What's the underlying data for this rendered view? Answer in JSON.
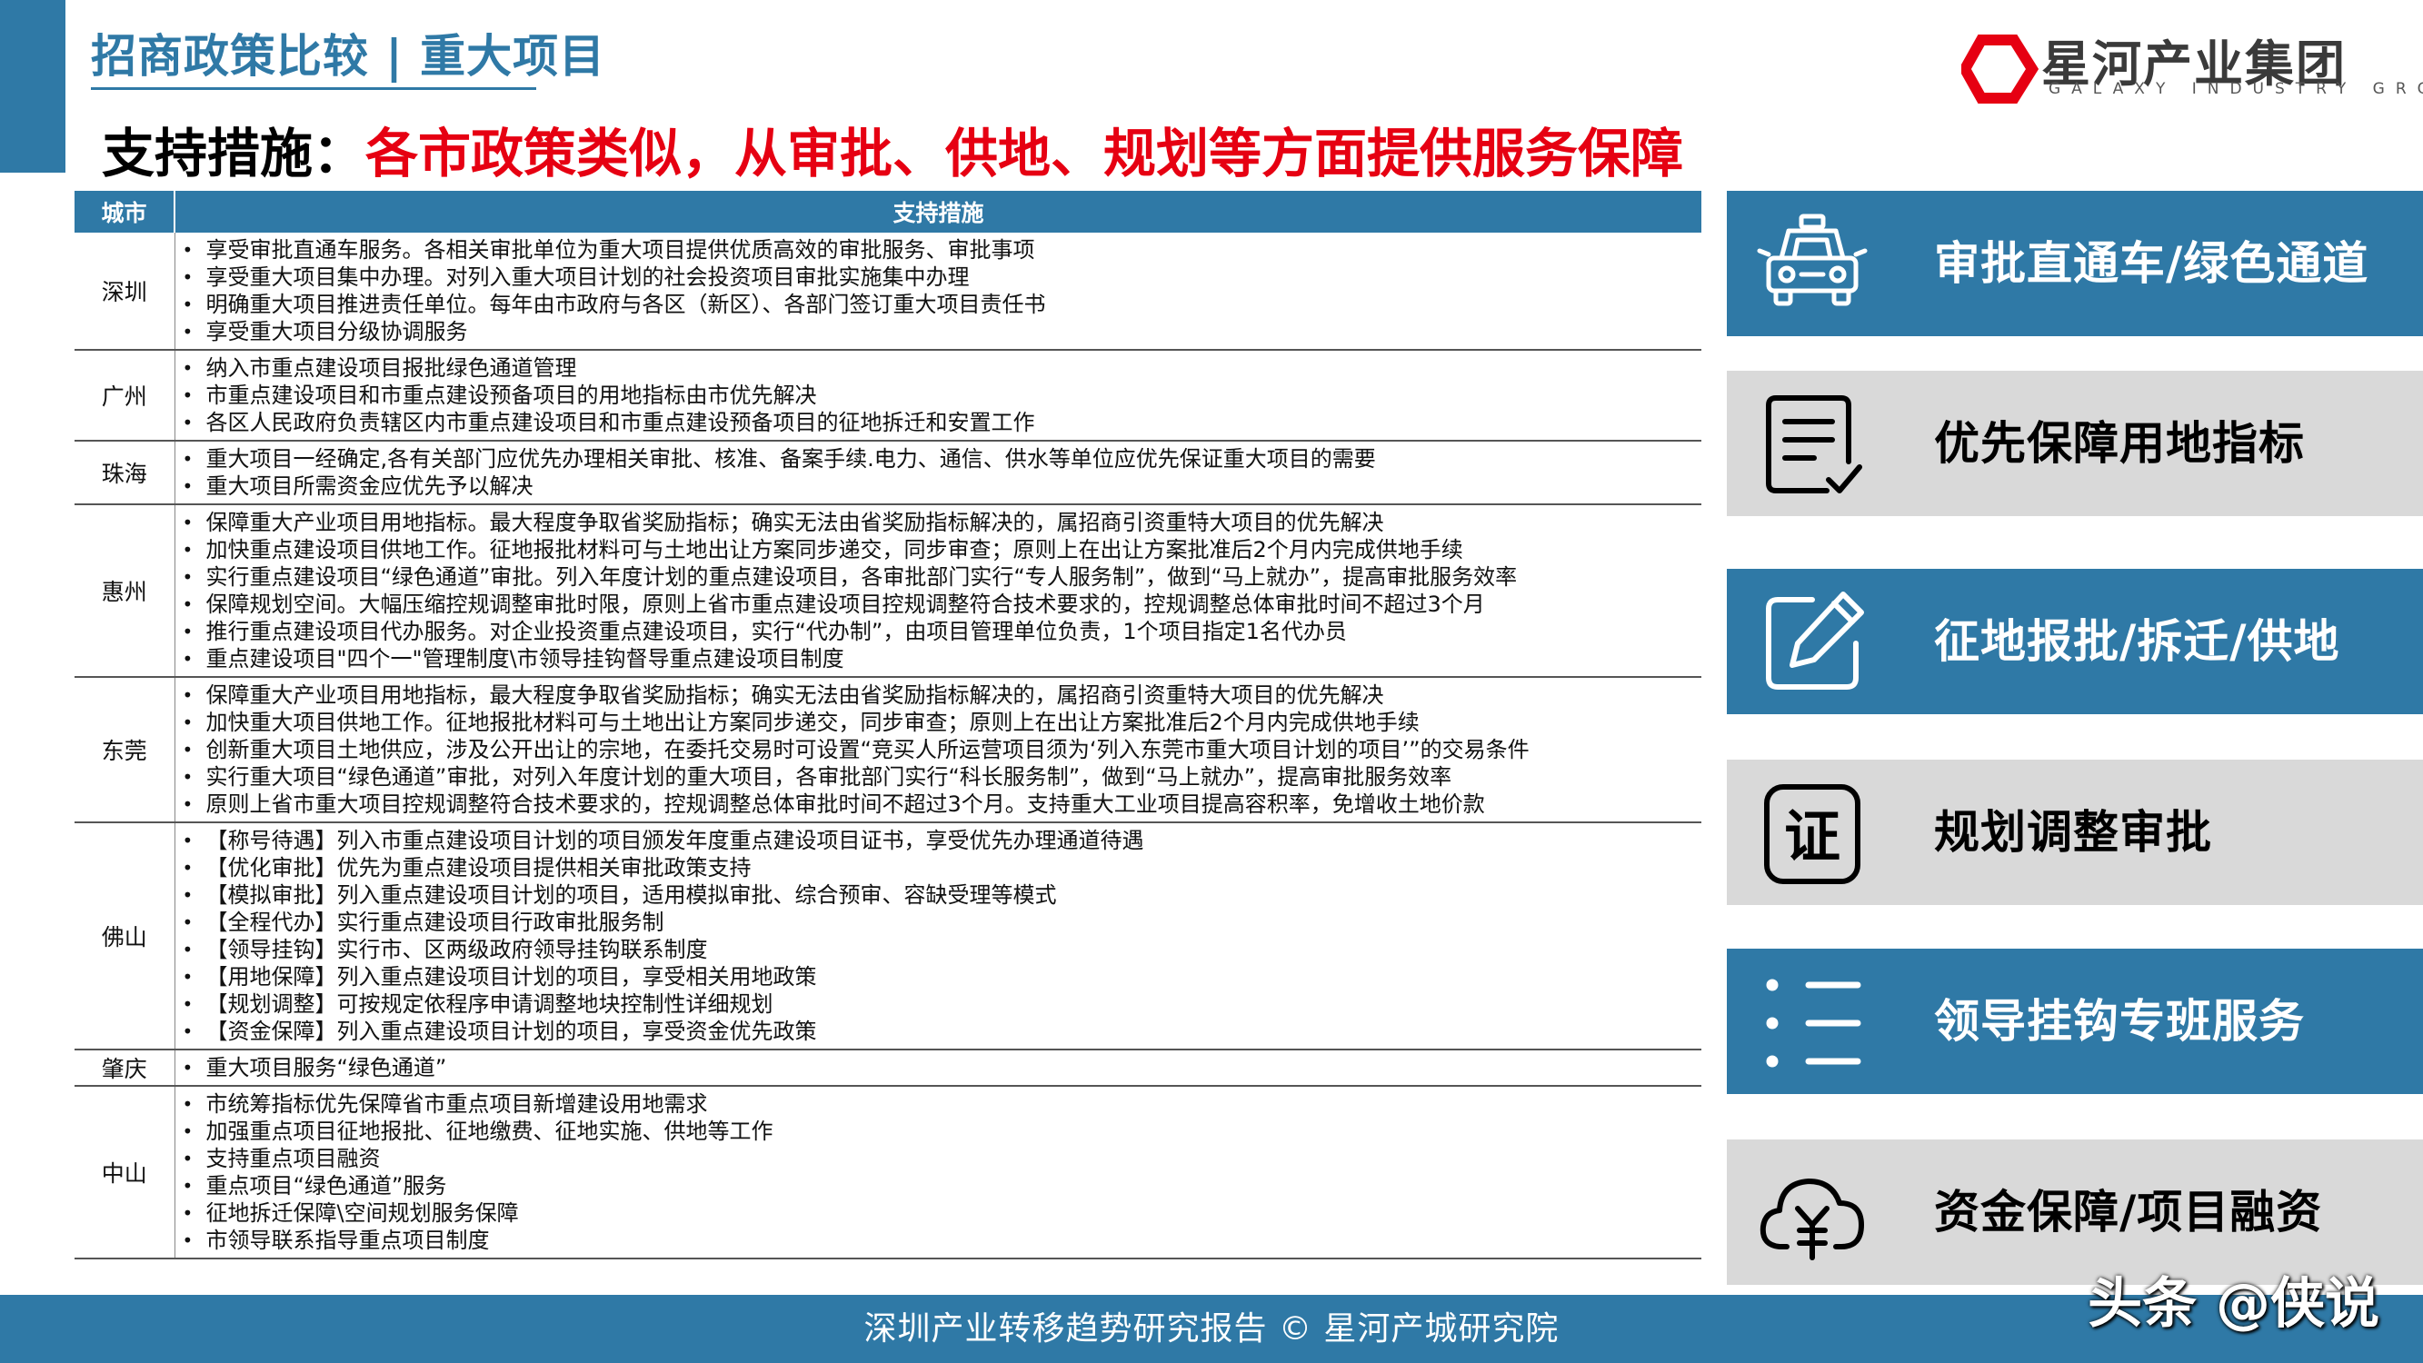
{
  "header": {
    "section_title": "招商政策比较 | 重大项目",
    "headline_prefix": "支持措施：",
    "headline_highlight": "各市政策类似，从审批、供地、规划等方面提供服务保障"
  },
  "logo": {
    "name": "星河产业集团",
    "subtitle": "GALAXY INDUSTRY GROUP",
    "icon": "hexagon-logo-icon",
    "color": "#e60012"
  },
  "table": {
    "headers": [
      "城市",
      "支持措施"
    ],
    "rows": [
      {
        "city": "深圳",
        "items": [
          "享受审批直通车服务。各相关审批单位为重大项目提供优质高效的审批服务、审批事项",
          "享受重大项目集中办理。对列入重大项目计划的社会投资项目审批实施集中办理",
          "明确重大项目推进责任单位。每年由市政府与各区（新区）、各部门签订重大项目责任书",
          "享受重大项目分级协调服务"
        ]
      },
      {
        "city": "广州",
        "items": [
          "纳入市重点建设项目报批绿色通道管理",
          "市重点建设项目和市重点建设预备项目的用地指标由市优先解决",
          "各区人民政府负责辖区内市重点建设项目和市重点建设预备项目的征地拆迁和安置工作"
        ]
      },
      {
        "city": "珠海",
        "items": [
          "重大项目一经确定,各有关部门应优先办理相关审批、核准、备案手续.电力、通信、供水等单位应优先保证重大项目的需要",
          "重大项目所需资金应优先予以解决"
        ]
      },
      {
        "city": "惠州",
        "items": [
          "保障重大产业项目用地指标。最大程度争取省奖励指标；确实无法由省奖励指标解决的，属招商引资重特大项目的优先解决",
          "加快重点建设项目供地工作。征地报批材料可与土地出让方案同步递交，同步审查；原则上在出让方案批准后2个月内完成供地手续",
          "实行重点建设项目“绿色通道”审批。列入年度计划的重点建设项目，各审批部门实行“专人服务制”，做到“马上就办”，提高审批服务效率",
          "保障规划空间。大幅压缩控规调整审批时限，原则上省市重点建设项目控规调整符合技术要求的，控规调整总体审批时间不超过3个月",
          "推行重点建设项目代办服务。对企业投资重点建设项目，实行“代办制”，由项目管理单位负责，1个项目指定1名代办员",
          "重点建设项目\"四个一\"管理制度\\市领导挂钩督导重点建设项目制度"
        ]
      },
      {
        "city": "东莞",
        "items": [
          "保障重大产业项目用地指标，最大程度争取省奖励指标；确实无法由省奖励指标解决的，属招商引资重特大项目的优先解决",
          "加快重大项目供地工作。征地报批材料可与土地出让方案同步递交，同步审查；原则上在出让方案批准后2个月内完成供地手续",
          "创新重大项目土地供应，涉及公开出让的宗地，在委托交易时可设置“竞买人所运营项目须为‘列入东莞市重大项目计划的项目’”的交易条件",
          "实行重大项目“绿色通道”审批，对列入年度计划的重大项目，各审批部门实行“科长服务制”，做到“马上就办”，提高审批服务效率",
          "原则上省市重大项目控规调整符合技术要求的，控规调整总体审批时间不超过3个月。支持重大工业项目提高容积率，免增收土地价款"
        ]
      },
      {
        "city": "佛山",
        "items": [
          "【称号待遇】列入市重点建设项目计划的项目颁发年度重点建设项目证书，享受优先办理通道待遇",
          "【优化审批】优先为重点建设项目提供相关审批政策支持",
          "【模拟审批】列入重点建设项目计划的项目，适用模拟审批、综合预审、容缺受理等模式",
          "【全程代办】实行重点建设项目行政审批服务制",
          "【领导挂钩】实行市、区两级政府领导挂钩联系制度",
          "【用地保障】列入重点建设项目计划的项目，享受相关用地政策",
          "【规划调整】可按规定依程序申请调整地块控制性详细规划",
          "【资金保障】列入重点建设项目计划的项目，享受资金优先政策"
        ]
      },
      {
        "city": "肇庆",
        "items": [
          "重大项目服务“绿色通道”"
        ]
      },
      {
        "city": "中山",
        "items": [
          "市统筹指标优先保障省市重点项目新增建设用地需求",
          "加强重点项目征地报批、征地缴费、征地实施、供地等工作",
          "支持重点项目融资",
          "重点项目“绿色通道”服务",
          "征地拆迁保障\\空间规划服务保障",
          "市领导联系指导重点项目制度"
        ]
      }
    ]
  },
  "features": [
    {
      "label": "审批直通车/绿色通道",
      "icon": "car-icon",
      "style": "blue"
    },
    {
      "label": "优先保障用地指标",
      "icon": "document-check-icon",
      "style": "grey"
    },
    {
      "label": "征地报批/拆迁/供地",
      "icon": "edit-pencil-icon",
      "style": "blue"
    },
    {
      "label": "规划调整审批",
      "icon": "certificate-icon",
      "style": "grey"
    },
    {
      "label": "领导挂钩专班服务",
      "icon": "list-icon",
      "style": "blue"
    },
    {
      "label": "资金保障/项目融资",
      "icon": "cloud-yuan-icon",
      "style": "grey"
    }
  ],
  "footer": {
    "text": "深圳产业转移趋势研究报告 © 星河产城研究院",
    "watermark": "头条 @侠说"
  },
  "colors": {
    "primary_blue": "#2f79a6",
    "highlight_red": "#e60012",
    "panel_grey": "#d9d9d9"
  }
}
